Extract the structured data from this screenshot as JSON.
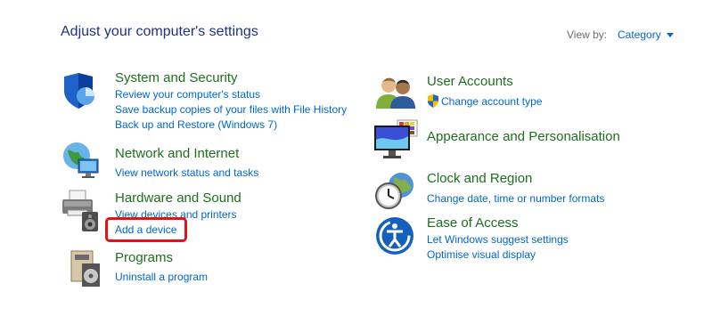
{
  "header": {
    "title": "Adjust your computer's settings",
    "view_by_label": "View by:",
    "view_by_value": "Category"
  },
  "left": {
    "system_security": {
      "title": "System and Security",
      "links": [
        "Review your computer's status",
        "Save backup copies of your files with File History",
        "Back up and Restore (Windows 7)"
      ]
    },
    "network": {
      "title": "Network and Internet",
      "links": [
        "View network status and tasks"
      ]
    },
    "hardware": {
      "title": "Hardware and Sound",
      "links": [
        "View devices and printers",
        "Add a device"
      ]
    },
    "programs": {
      "title": "Programs",
      "links": [
        "Uninstall a program"
      ]
    }
  },
  "right": {
    "user_accounts": {
      "title": "User Accounts",
      "links": [
        "Change account type"
      ]
    },
    "appearance": {
      "title": "Appearance and Personalisation"
    },
    "clock": {
      "title": "Clock and Region",
      "links": [
        "Change date, time or number formats"
      ]
    },
    "ease": {
      "title": "Ease of Access",
      "links": [
        "Let Windows suggest settings",
        "Optimise visual display"
      ]
    }
  },
  "colors": {
    "title": "#1e3287",
    "category": "#1e6e1e",
    "link": "#0066cc",
    "highlight": "#e0131b"
  }
}
